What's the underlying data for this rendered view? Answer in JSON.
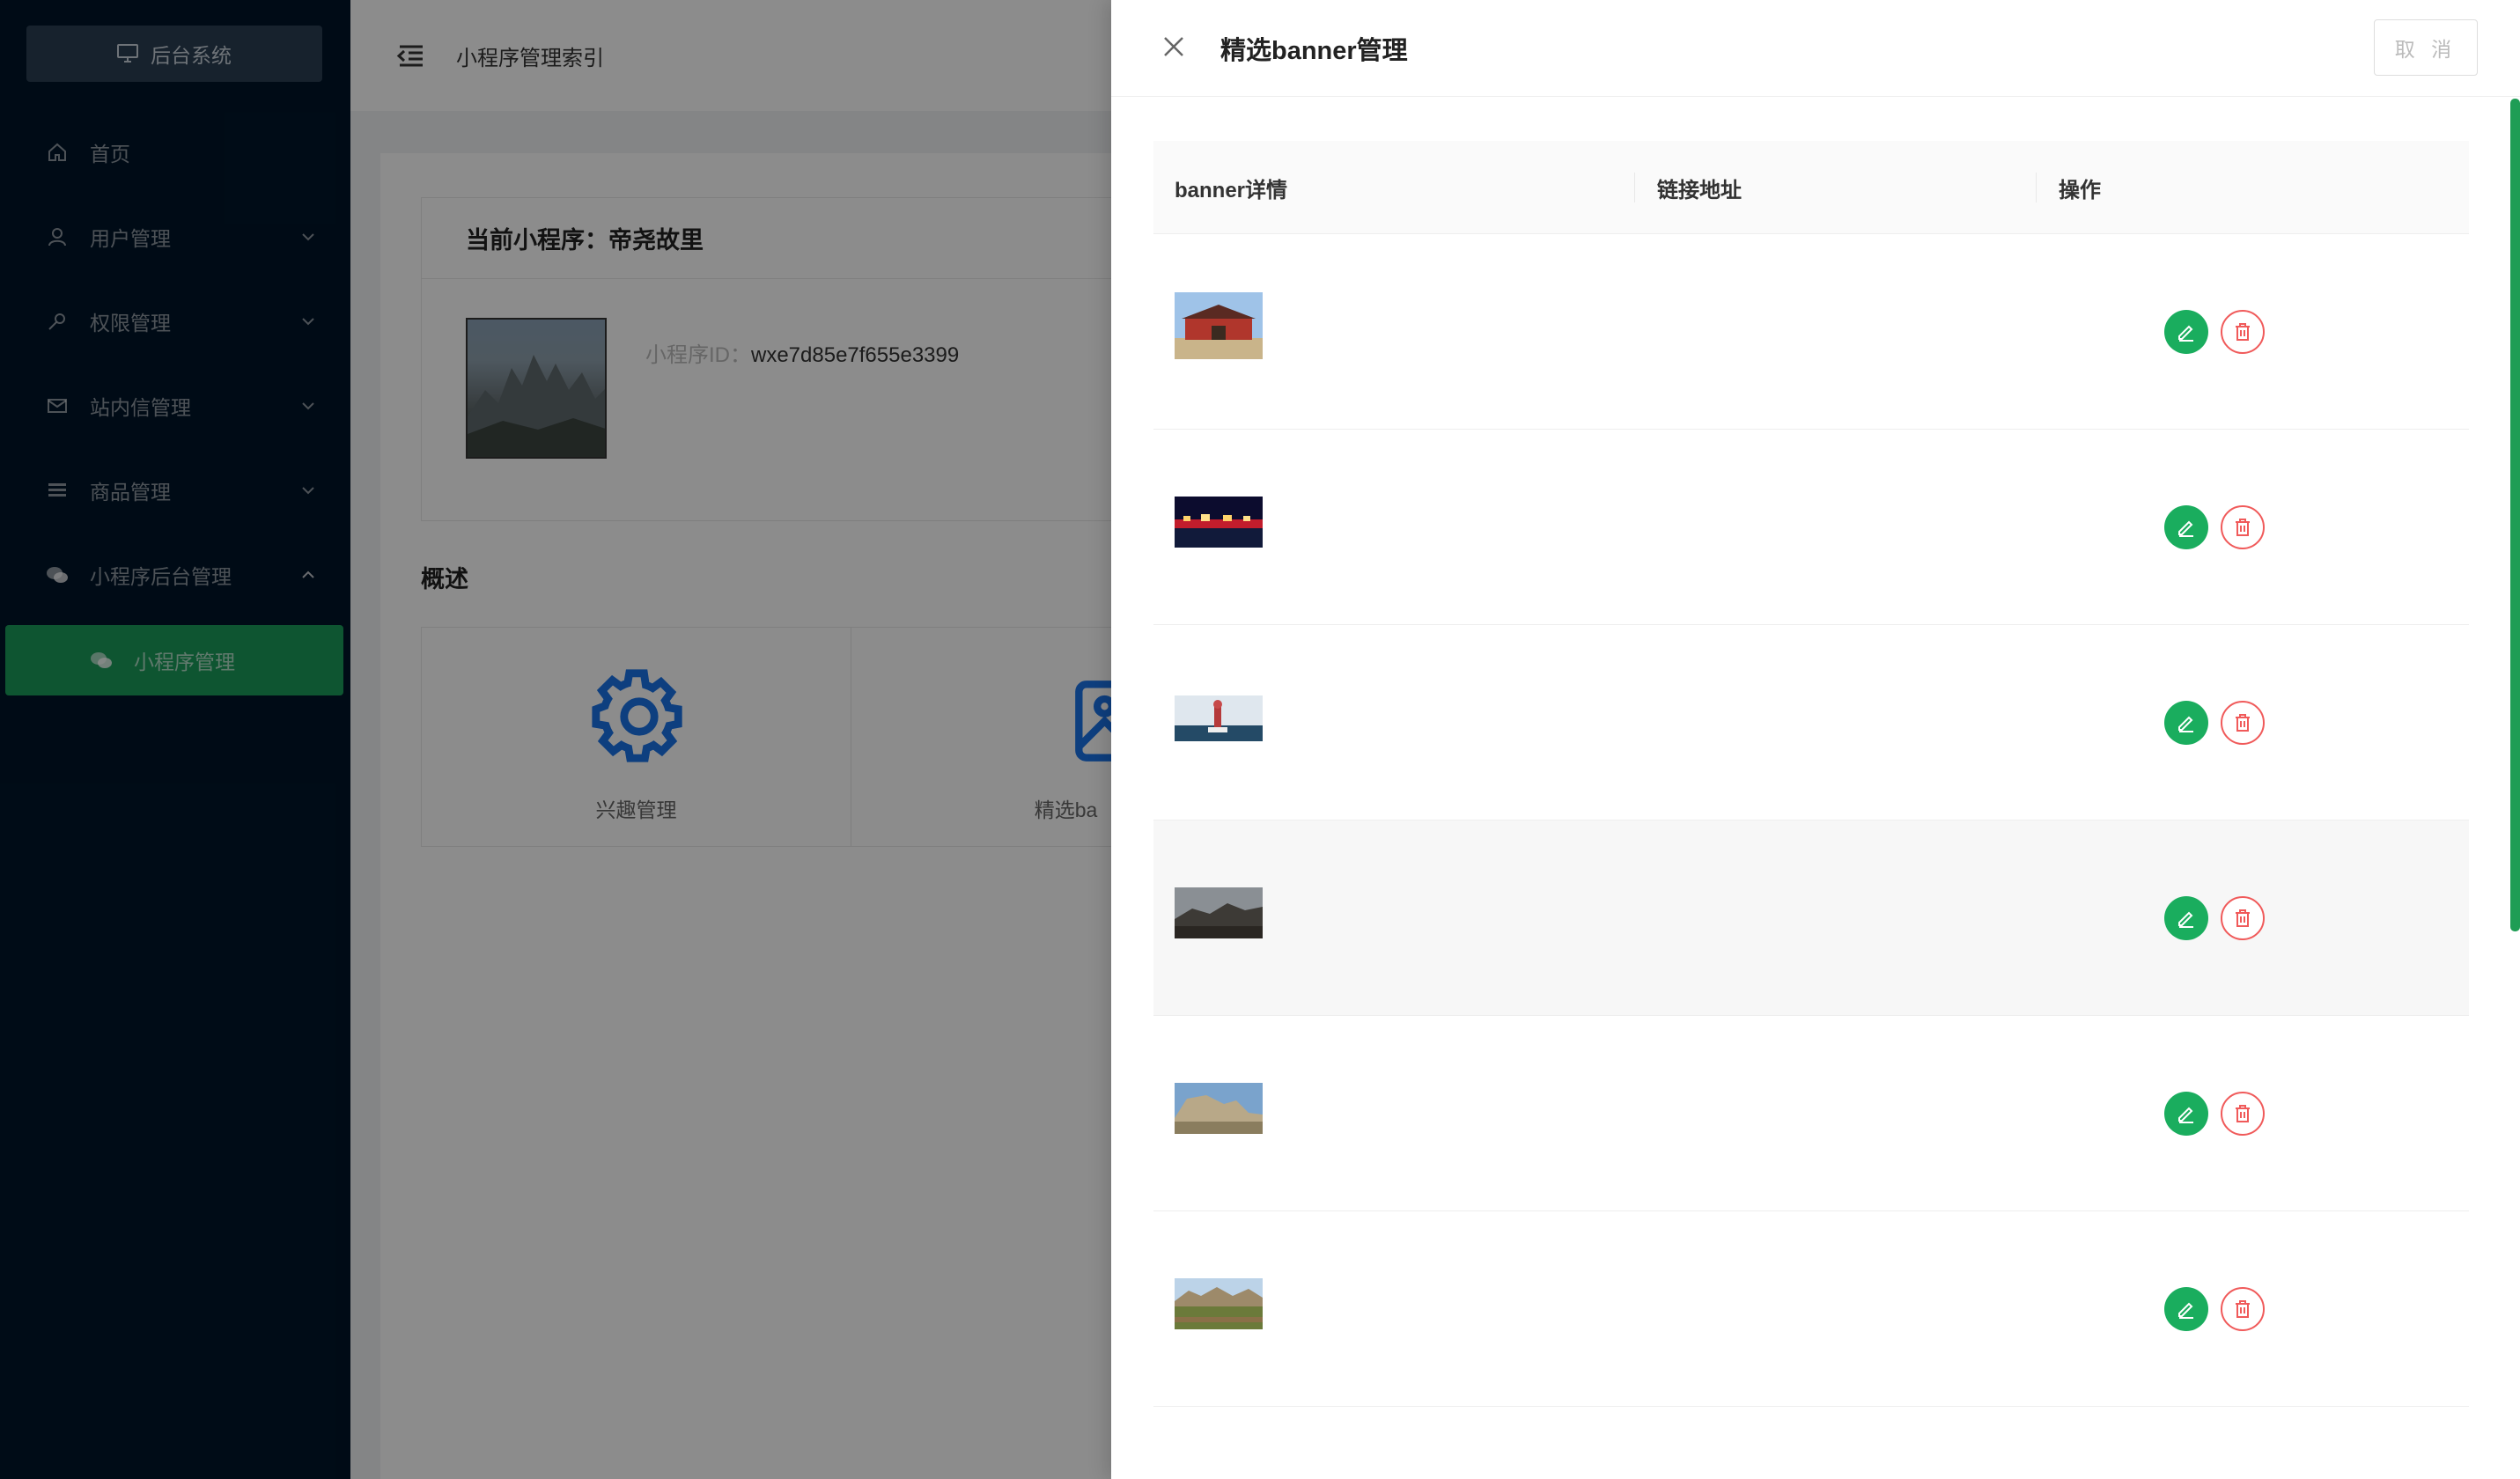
{
  "sidebar": {
    "brand_label": "后台系统",
    "items": [
      {
        "label": "首页",
        "icon": "home-icon"
      },
      {
        "label": "用户管理",
        "icon": "user-icon"
      },
      {
        "label": "权限管理",
        "icon": "key-icon"
      },
      {
        "label": "站内信管理",
        "icon": "mail-icon"
      },
      {
        "label": "商品管理",
        "icon": "list-icon"
      },
      {
        "label": "小程序后台管理",
        "icon": "wechat-icon"
      }
    ],
    "sub_item_label": "小程序管理",
    "active_color": "#1a9b5a"
  },
  "header": {
    "breadcrumb": "小程序管理索引"
  },
  "main": {
    "card_title": "当前小程序：帝尧故里",
    "app_id_label": "小程序ID：",
    "app_id_value": "wxe7d85e7f655e3399",
    "overview_title": "概述",
    "overview_items": [
      {
        "label": "兴趣管理",
        "icon": "gear-icon"
      },
      {
        "label": "精选ba",
        "icon": "image-icon"
      }
    ]
  },
  "drawer": {
    "title": "精选banner管理",
    "cancel_label": "取 消",
    "columns": [
      "banner详情",
      "链接地址",
      "操作"
    ],
    "rows": [
      {
        "image": "banner-temple-gate",
        "link": ""
      },
      {
        "image": "banner-night-lights",
        "link": ""
      },
      {
        "image": "banner-monument",
        "link": ""
      },
      {
        "image": "banner-mountain-dusk",
        "link": ""
      },
      {
        "image": "banner-rock-cliff",
        "link": ""
      },
      {
        "image": "banner-field-mountains",
        "link": ""
      }
    ],
    "accent": "#1aad5e",
    "danger": "#f05a5a"
  }
}
